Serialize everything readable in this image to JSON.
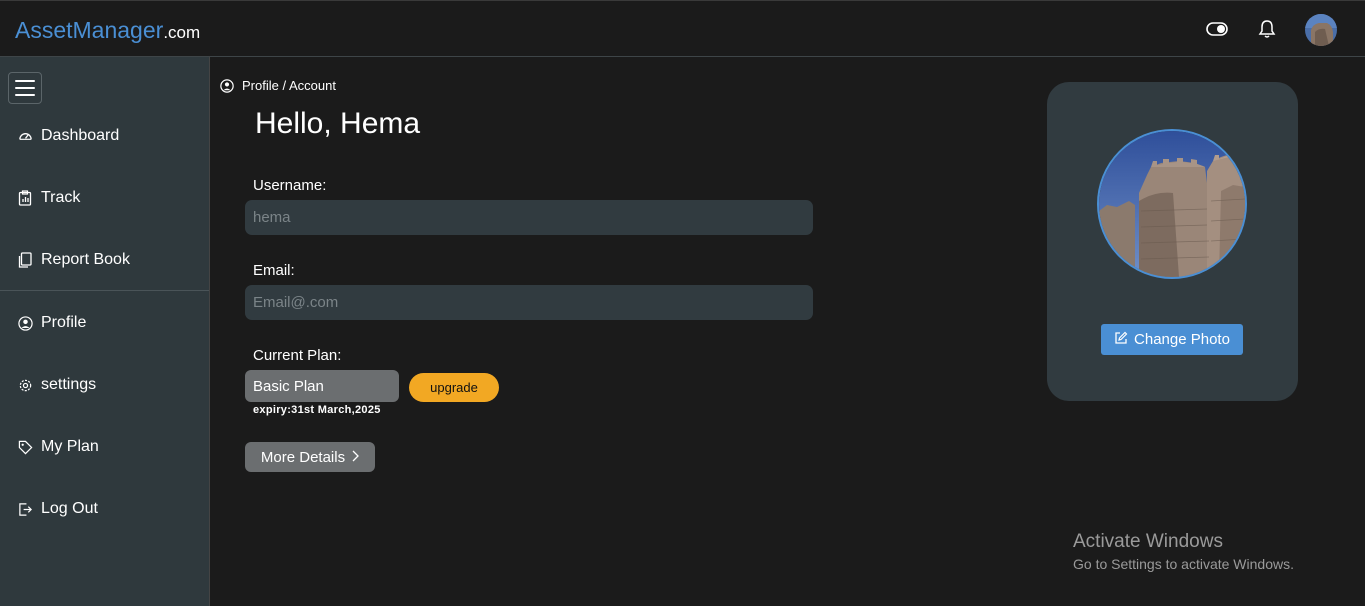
{
  "header": {
    "brand_main": "AssetManager",
    "brand_tld": ".com",
    "toggle_icon": "toggle-icon",
    "bell_icon": "bell-icon",
    "avatar": "user-avatar",
    "accent_color": "#4a8fd4"
  },
  "sidebar": {
    "menu_icon": "hamburger-icon",
    "items": [
      {
        "label": "Dashboard",
        "icon": "speedometer-icon"
      },
      {
        "label": "Track",
        "icon": "clipboard-icon"
      },
      {
        "label": "Report Book",
        "icon": "copy-icon"
      },
      {
        "label": "Profile",
        "icon": "user-circle-icon"
      },
      {
        "label": "settings",
        "icon": "gear-icon"
      },
      {
        "label": "My Plan",
        "icon": "tag-icon"
      },
      {
        "label": "Log Out",
        "icon": "logout-icon"
      }
    ]
  },
  "main": {
    "breadcrumb": "Profile / Account",
    "greeting": "Hello, Hema",
    "username_label": "Username:",
    "username_placeholder": "hema",
    "email_label": "Email:",
    "email_placeholder": "Email@.com",
    "plan_label": "Current Plan:",
    "plan_value": "Basic Plan",
    "upgrade_label": "upgrade",
    "expiry": "expiry:31st March,2025",
    "more_details_label": "More Details",
    "upgrade_color": "#f2a823"
  },
  "photo_card": {
    "change_photo_label": "Change Photo"
  },
  "watermark": {
    "line1": "Activate Windows",
    "line2": "Go to Settings to activate Windows."
  }
}
